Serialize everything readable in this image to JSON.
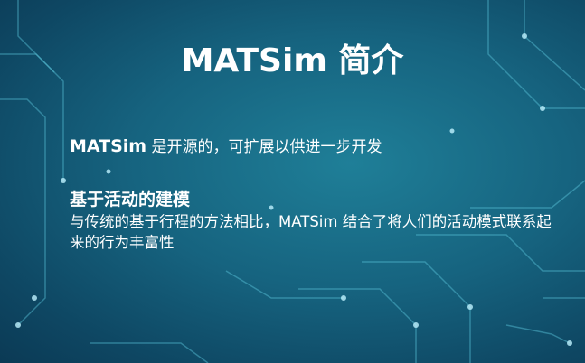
{
  "slide": {
    "title": "MATSim 简介",
    "point1": {
      "bold": "MATSim",
      "text": " 是开源的，可扩展以供进一步开发"
    },
    "heading2": "基于活动的建模",
    "paragraph": "与传统的基于行程的方法相比，MATSim 结合了将人们的活动模式联系起来的行为丰富性"
  },
  "colors": {
    "background": "#16637f",
    "circuit": "#6fd6e8",
    "text": "#ffffff"
  }
}
